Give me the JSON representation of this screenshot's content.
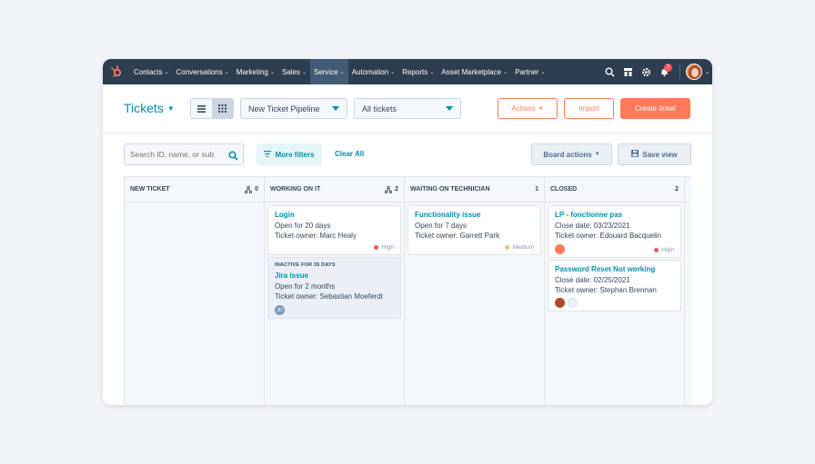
{
  "nav": {
    "items": [
      {
        "label": "Contacts"
      },
      {
        "label": "Conversations"
      },
      {
        "label": "Marketing"
      },
      {
        "label": "Sales"
      },
      {
        "label": "Service"
      },
      {
        "label": "Automation"
      },
      {
        "label": "Reports"
      },
      {
        "label": "Asset Marketplace"
      },
      {
        "label": "Partner"
      }
    ],
    "notifications_count": "7"
  },
  "header": {
    "title": "Tickets",
    "pipeline": "New Ticket Pipeline",
    "view": "All tickets",
    "actions_label": "Actions",
    "import_label": "Import",
    "create_label": "Create ticket"
  },
  "filters": {
    "search_placeholder": "Search ID, name, or sub",
    "more_filters": "More filters",
    "clear_all": "Clear All",
    "board_actions": "Board actions",
    "save_view": "Save view"
  },
  "columns": [
    {
      "name": "NEW TICKET",
      "count": "0"
    },
    {
      "name": "WORKING ON IT",
      "count": "2"
    },
    {
      "name": "WAITING ON TECHNICIAN",
      "count": "1"
    },
    {
      "name": "CLOSED",
      "count": "2"
    }
  ],
  "cards": {
    "login": {
      "title": "Login",
      "line1": "Open for 20 days",
      "owner": "Ticket owner: Marc Healy",
      "priority": "High"
    },
    "jira": {
      "inactive": "INACTIVE FOR 35 DAYS",
      "title": "Jira issue",
      "line1": "Open for 2 months",
      "owner": "Ticket owner: Sebastian Moeferdt",
      "avatar_initials": "JD"
    },
    "functionality": {
      "title": "Functionality issue",
      "line1": "Open for 7 days",
      "owner": "Ticket owner: Garrett Park",
      "priority": "Medium"
    },
    "lp": {
      "title": "LP - fonctionne pas",
      "line1": "Close date: 03/23/2021",
      "owner": "Ticket owner: Edouard Bacquelin",
      "priority": "High"
    },
    "password": {
      "title": "Password Reset Not working",
      "line1": "Close date: 02/25/2021",
      "owner": "Ticket owner: Stephan Brennan"
    }
  },
  "colors": {
    "nav_bg": "#2d3e50",
    "accent_teal": "#0091ae",
    "accent_orange": "#ff7a59",
    "priority_high": "#f2545b",
    "priority_medium": "#f5c26b"
  }
}
